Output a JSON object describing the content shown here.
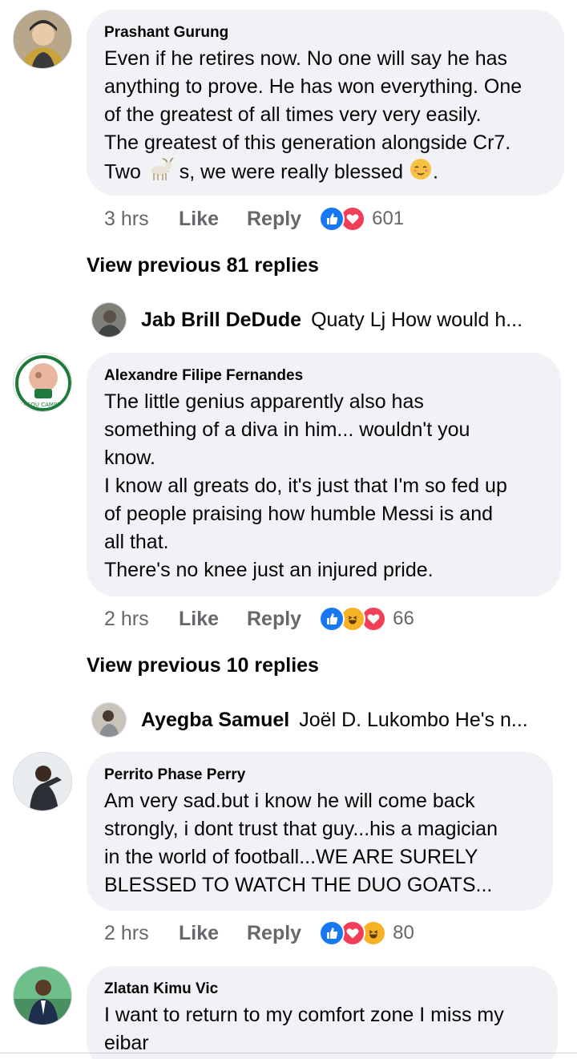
{
  "comments": [
    {
      "author": "Prashant Gurung",
      "lines": [
        "Even if he retires now. No one will say he has",
        "anything to prove. He has won everything. One",
        "of the greatest of all times very very easily.",
        "The greatest of this generation alongside Cr7."
      ],
      "last_line_a": "Two ",
      "last_line_b": " s, we were really blessed ",
      "last_line_c": ".",
      "time": "3 hrs",
      "like_label": "Like",
      "reply_label": "Reply",
      "reactions": [
        "like",
        "love"
      ],
      "reaction_count": "601"
    },
    {
      "author": "Alexandre Filipe Fernandes",
      "lines": [
        "The little genius apparently also has",
        "something of a diva in him... wouldn't you",
        "know.",
        "I know all greats do, it's just that I'm so fed up",
        "of people praising how humble Messi is and",
        "all that.",
        "There's no knee just an injured pride."
      ],
      "time": "2 hrs",
      "like_label": "Like",
      "reply_label": "Reply",
      "reactions": [
        "like",
        "haha",
        "love"
      ],
      "reaction_count": "66"
    },
    {
      "author": "Perrito Phase Perry",
      "lines": [
        "Am very sad.but i know he will come back",
        "strongly, i dont trust that guy...his a magician",
        "in the world of football...WE ARE SURELY",
        "BLESSED TO WATCH THE DUO GOATS..."
      ],
      "time": "2 hrs",
      "like_label": "Like",
      "reply_label": "Reply",
      "reactions": [
        "like",
        "love",
        "haha"
      ],
      "reaction_count": "80"
    },
    {
      "author": "Zlatan Kimu Vic",
      "lines": [
        "I want to return to my comfort zone I miss my",
        "eibar"
      ]
    }
  ],
  "view_previous": [
    "View previous 81 replies",
    "View previous 10 replies"
  ],
  "reply_previews": [
    {
      "name": "Jab Brill DeDude",
      "text": "Quaty Lj How would h..."
    },
    {
      "name": "Ayegba Samuel",
      "text": "Joël D. Lukombo He's n..."
    }
  ],
  "colors": {
    "bubble": "#f0f2f5",
    "secondary_text": "#65676b",
    "like_blue": "#1877f2",
    "love_red": "#f33e58",
    "haha_yellow": "#f7b125"
  }
}
